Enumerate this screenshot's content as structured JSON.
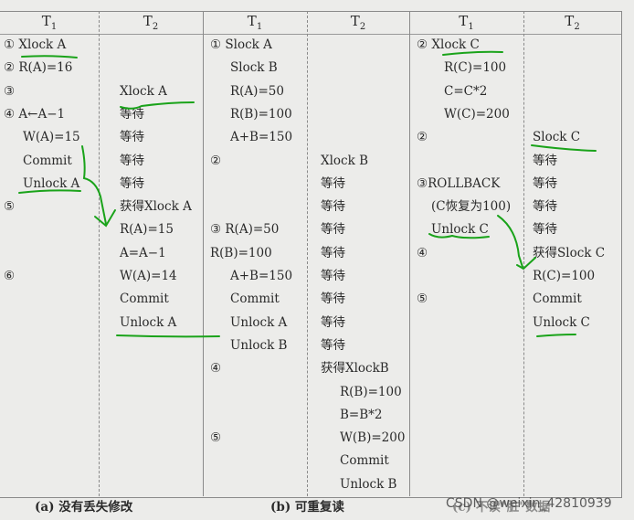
{
  "sections": [
    {
      "caption": "(a) 没有丢失修改",
      "columns": [
        {
          "header": "T",
          "sub": "1",
          "rows": [
            "① Xlock A",
            "② R(A)=16",
            "③",
            "④ A←A−1",
            "W(A)=15",
            "Commit",
            "Unlock A",
            "⑤",
            "",
            "",
            "⑥"
          ]
        },
        {
          "header": "T",
          "sub": "2",
          "rows": [
            "",
            "",
            "Xlock A",
            "等待",
            "等待",
            "等待",
            "等待",
            "获得Xlock A",
            "R(A)=15",
            "A=A−1",
            "W(A)=14",
            "Commit",
            "Unlock A"
          ]
        }
      ]
    },
    {
      "caption": "(b) 可重复读",
      "columns": [
        {
          "header": "T",
          "sub": "1",
          "rows": [
            "① Slock A",
            "Slock B",
            "R(A)=50",
            "R(B)=100",
            "A+B=150",
            "②",
            "",
            "",
            "③ R(A)=50",
            "R(B)=100",
            "A+B=150",
            "Commit",
            "Unlock A",
            "Unlock B",
            "④",
            "",
            "",
            "⑤"
          ]
        },
        {
          "header": "T",
          "sub": "2",
          "rows": [
            "",
            "",
            "",
            "",
            "",
            "Xlock B",
            "等待",
            "等待",
            "等待",
            "等待",
            "等待",
            "等待",
            "等待",
            "等待",
            "获得XlockB",
            "R(B)=100",
            "B=B*2",
            "W(B)=200",
            "Commit",
            "Unlock B"
          ]
        }
      ]
    },
    {
      "caption": "(c) 不读\"脏\"数据",
      "columns": [
        {
          "header": "T",
          "sub": "1",
          "rows": [
            "② Xlock C",
            "R(C)=100",
            "C=C*2",
            "W(C)=200",
            "②",
            "",
            "③ROLLBACK",
            "(C恢复为100)",
            "Unlock C",
            "④",
            "",
            "⑤"
          ]
        },
        {
          "header": "T",
          "sub": "2",
          "rows": [
            "",
            "",
            "",
            "",
            "Slock C",
            "等待",
            "等待",
            "等待",
            "等待",
            "获得Slock C",
            "R(C)=100",
            "Commit",
            "Unlock C"
          ]
        }
      ]
    }
  ],
  "watermark": "CSDN @weixin_42810939",
  "annotation_color": "#1aa31a"
}
